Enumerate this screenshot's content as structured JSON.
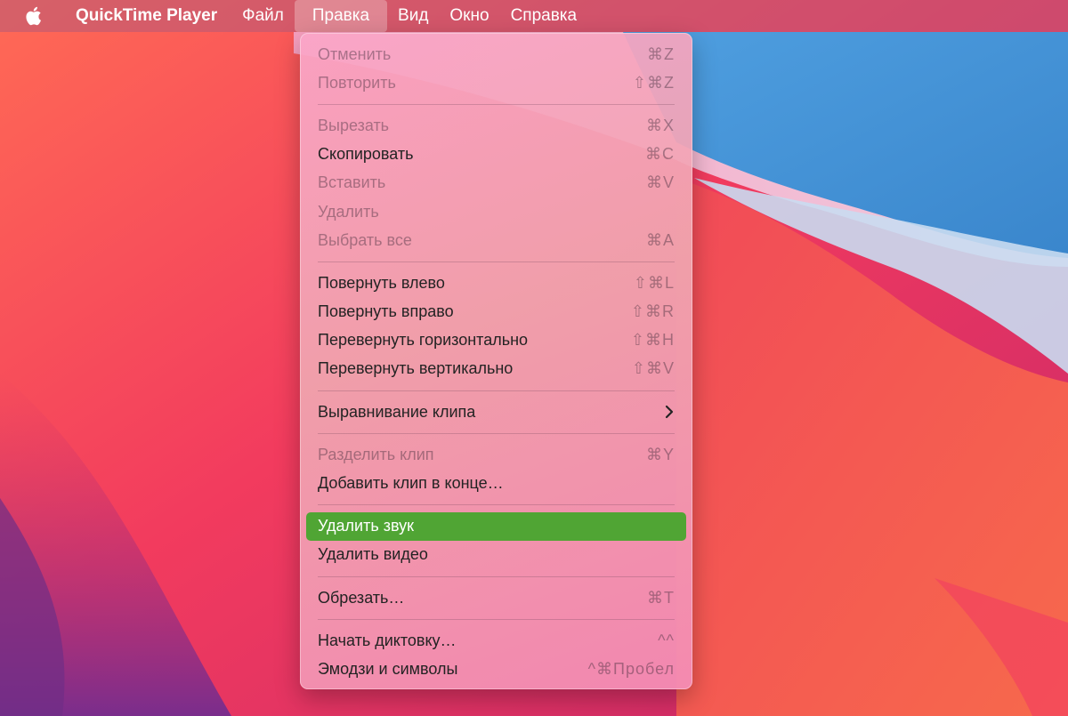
{
  "menubar": {
    "app_name": "QuickTime Player",
    "items": [
      "Файл",
      "Правка",
      "Вид",
      "Окно",
      "Справка"
    ],
    "active_item": "Правка"
  },
  "edit_menu": {
    "undo": {
      "label": "Отменить",
      "shortcut": "⌘Z"
    },
    "redo": {
      "label": "Повторить",
      "shortcut": "⇧⌘Z"
    },
    "cut": {
      "label": "Вырезать",
      "shortcut": "⌘X"
    },
    "copy": {
      "label": "Скопировать",
      "shortcut": "⌘C"
    },
    "paste": {
      "label": "Вставить",
      "shortcut": "⌘V"
    },
    "delete": {
      "label": "Удалить"
    },
    "select_all": {
      "label": "Выбрать все",
      "shortcut": "⌘A"
    },
    "rotate_left": {
      "label": "Повернуть влево",
      "shortcut": "⇧⌘L"
    },
    "rotate_right": {
      "label": "Повернуть вправо",
      "shortcut": "⇧⌘R"
    },
    "flip_horizontal": {
      "label": "Перевернуть горизонтально",
      "shortcut": "⇧⌘H"
    },
    "flip_vertical": {
      "label": "Перевернуть вертикально",
      "shortcut": "⇧⌘V"
    },
    "align_clip": {
      "label": "Выравнивание клипа"
    },
    "split_clip": {
      "label": "Разделить клип",
      "shortcut": "⌘Y"
    },
    "add_clip_end": {
      "label": "Добавить клип в конце…"
    },
    "remove_audio": {
      "label": "Удалить звук"
    },
    "remove_video": {
      "label": "Удалить видео"
    },
    "trim": {
      "label": "Обрезать…",
      "shortcut": "⌘T"
    },
    "start_dictation": {
      "label": "Начать диктовку…",
      "shortcut": "^^"
    },
    "emoji_symbols": {
      "label": "Эмодзи и символы",
      "shortcut": "^⌘Пробел"
    }
  },
  "colors": {
    "highlight": "#50a534",
    "wallpaper_red": "#e8385a",
    "wallpaper_blue": "#3f8fd0"
  },
  "icons": {
    "apple": "apple-logo-icon",
    "submenu": "chevron-right-icon"
  }
}
